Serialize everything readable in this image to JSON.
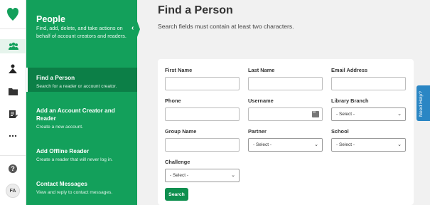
{
  "brand": {
    "accent": "#13a05b",
    "accent_dark": "#0c7f47",
    "help_blue": "#2a86c4"
  },
  "rail": {
    "icons": [
      "heart-logo",
      "people-icon",
      "reader-icon",
      "folder-icon",
      "report-icon",
      "more-icon",
      "help-icon"
    ],
    "avatar_initials": "FA"
  },
  "panel": {
    "title": "People",
    "description": "Find, add, delete, and take actions on behalf of account creators and readers.",
    "collapse_glyph": "‹",
    "items": [
      {
        "title": "Find a Person",
        "subtitle": "Search for a reader or account creator."
      },
      {
        "title": "Add an Account Creator and Reader",
        "subtitle": "Create a new account."
      },
      {
        "title": "Add Offline Reader",
        "subtitle": "Create a reader that will never log in."
      },
      {
        "title": "Contact Messages",
        "subtitle": "View and reply to contact messages."
      }
    ]
  },
  "main": {
    "title": "Find a Person",
    "subtitle": "Search fields must contain at least two characters.",
    "form": {
      "first_name": "First Name",
      "last_name": "Last Name",
      "email": "Email Address",
      "phone": "Phone",
      "username": "Username",
      "library_branch": "Library Branch",
      "group_name": "Group Name",
      "partner": "Partner",
      "school": "School",
      "challenge": "Challenge",
      "select_placeholder": "- Select -",
      "search_button": "Search"
    }
  },
  "need_help": "Need Help?"
}
